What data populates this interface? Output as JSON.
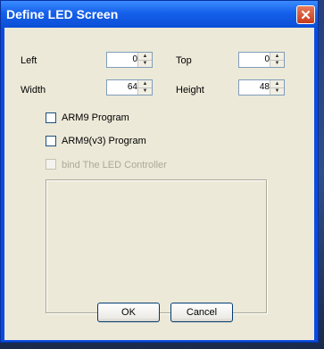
{
  "window": {
    "title": "Define LED Screen",
    "close_glyph": "✕"
  },
  "fields": {
    "left": {
      "label": "Left",
      "value": "0"
    },
    "top": {
      "label": "Top",
      "value": "0"
    },
    "width": {
      "label": "Width",
      "value": "64"
    },
    "height": {
      "label": "Height",
      "value": "48"
    }
  },
  "options": {
    "arm9": {
      "label": "ARM9 Program",
      "checked": false,
      "enabled": true
    },
    "arm9v3": {
      "label": "ARM9(v3) Program",
      "checked": false,
      "enabled": true
    },
    "bind_led": {
      "label": "bind The LED Controller",
      "checked": false,
      "enabled": false
    }
  },
  "buttons": {
    "ok": "OK",
    "cancel": "Cancel"
  },
  "icons": {
    "close": "close-icon",
    "spin_up": "up-arrow-icon",
    "spin_down": "down-arrow-icon"
  }
}
